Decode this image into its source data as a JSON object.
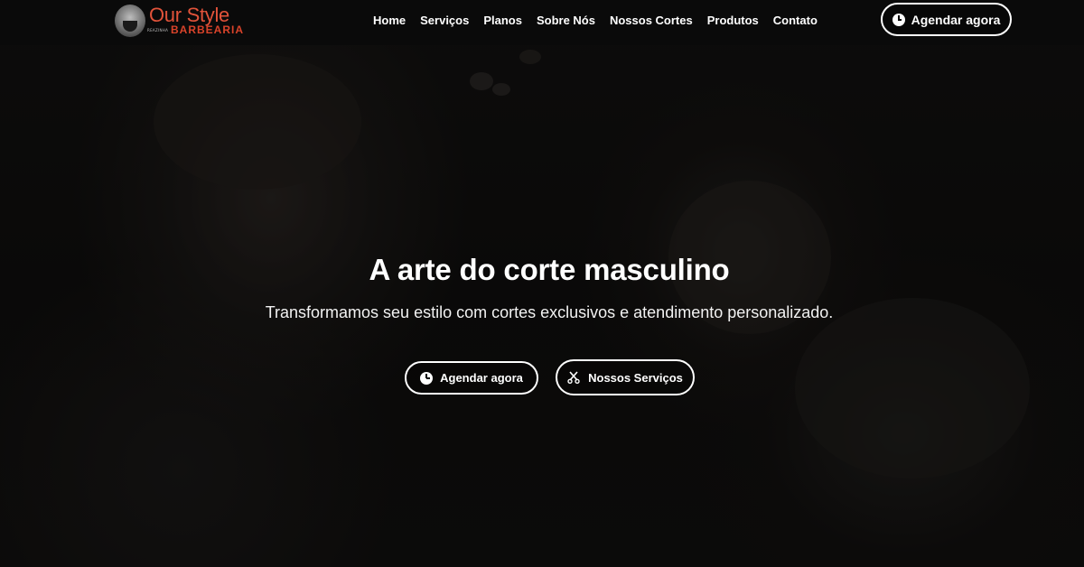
{
  "brand": {
    "name": "Our Style",
    "subtitle": "BARBEARIA",
    "tagline": "REAZINHA"
  },
  "nav": {
    "items": [
      "Home",
      "Serviços",
      "Planos",
      "Sobre Nós",
      "Nossos Cortes",
      "Produtos",
      "Contato"
    ]
  },
  "header": {
    "cta_label": "Agendar agora",
    "cta_icon": "clock-icon"
  },
  "hero": {
    "title": "A arte do corte masculino",
    "subtitle": "Transformamos seu estilo com cortes exclusivos e atendimento personalizado.",
    "primary_button": {
      "label": "Agendar agora",
      "icon": "clock-icon"
    },
    "secondary_button": {
      "label": "Nossos Serviços",
      "icon": "scissors-icon"
    }
  },
  "colors": {
    "brand_accent": "#e2533a",
    "header_bg": "#0a0a0a",
    "text": "#ffffff"
  }
}
